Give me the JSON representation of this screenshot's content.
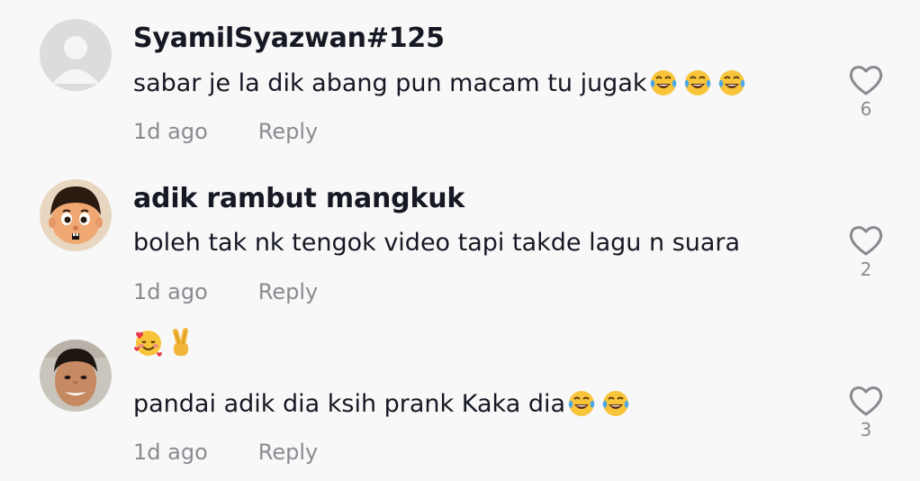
{
  "comments": [
    {
      "username": "SyamilSyazwan#125",
      "text": "sabar je la dik abang pun macam tu jugak",
      "emojis": [
        "face-with-tears-of-joy",
        "face-with-tears-of-joy",
        "face-with-tears-of-joy"
      ],
      "avatar": "default-avatar",
      "time": "1d ago",
      "reply_label": "Reply",
      "likes": "6"
    },
    {
      "username": "adik rambut mangkuk",
      "text": "boleh tak nk tengok video tapi takde lagu n suara",
      "emojis": [],
      "avatar": "cartoon-boy-avatar",
      "time": "1d ago",
      "reply_label": "Reply",
      "likes": "2"
    },
    {
      "username": "",
      "username_emojis": [
        "smiling-face-with-hearts",
        "victory-hand"
      ],
      "text": "pandai adik dia ksih prank Kaka dia",
      "emojis": [
        "face-with-tears-of-joy",
        "face-with-tears-of-joy"
      ],
      "avatar": "photo-avatar",
      "time": "1d ago",
      "reply_label": "Reply",
      "likes": "3"
    }
  ],
  "colors": {
    "background": "#f8f8f8",
    "text": "#161823",
    "secondary": "#8a8b91",
    "default_avatar": "#dcdcdc"
  }
}
